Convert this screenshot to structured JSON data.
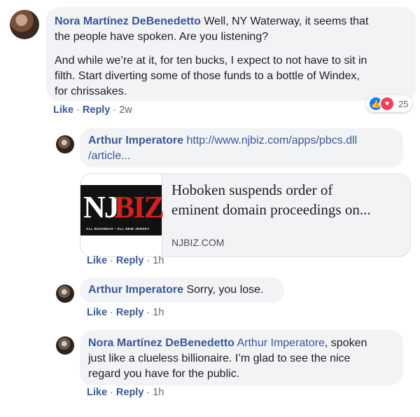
{
  "comments": [
    {
      "author": "Nora Martínez DeBenedetto",
      "text_line1": " Well, NY Waterway, it seems that",
      "text_line2": "the people have spoken. Are you listening?",
      "para2_line1": "And while we’re at it, for ten bucks, I expect to not have to sit in",
      "para2_line2": "filth. Start diverting some of those funds to a bottle of Windex,",
      "para2_line3": "for chrissakes.",
      "like": "Like",
      "reply": "Reply",
      "sep": " · ",
      "time": "2w",
      "reaction_count": "25"
    },
    {
      "author": "Arthur Imperatore",
      "link_line1": " http://www.njbiz.com/apps/pbcs.dll",
      "link_line2": "/article...",
      "card": {
        "logo_nj": "NJ",
        "logo_biz": "BIZ",
        "logo_tagline": "ALL BUSINESS • ALL NEW JERSEY",
        "title_line1": "Hoboken suspends order of",
        "title_line2": "eminent domain proceedings on...",
        "domain": "NJBIZ.COM"
      },
      "like": "Like",
      "reply": "Reply",
      "sep": " · ",
      "time": "1h"
    },
    {
      "author": "Arthur Imperatore",
      "text": " Sorry, you lose.",
      "like": "Like",
      "reply": "Reply",
      "sep": " · ",
      "time": "1h"
    },
    {
      "author": "Nora Martínez DeBenedetto",
      "mention": " Arthur Imperatore",
      "text_line1": ", spoken",
      "text_line2": "just like a clueless billionaire. I’m glad to see the nice",
      "text_line3": "regard you have for the public.",
      "like": "Like",
      "reply": "Reply",
      "sep": " · ",
      "time": "1h"
    }
  ],
  "icons": {
    "like_reaction": "thumbs-up-icon",
    "love_reaction": "heart-icon"
  },
  "colors": {
    "name": "#385898",
    "bubble": "#f2f3f5",
    "like_blue": "#1877f2",
    "love_red": "#f33e58",
    "logo_red": "#d91e1e"
  }
}
